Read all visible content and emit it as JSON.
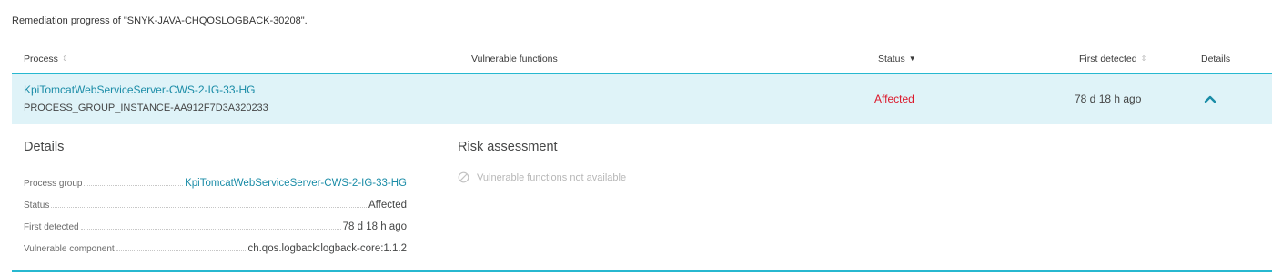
{
  "caption": "Remediation progress of \"SNYK-JAVA-CHQOSLOGBACK-30208\".",
  "table": {
    "headers": {
      "process": "Process",
      "vulnerable_functions": "Vulnerable functions",
      "status": "Status",
      "first_detected": "First detected",
      "details": "Details"
    },
    "rows": [
      {
        "process_name": "KpiTomcatWebServiceServer-CWS-2-IG-33-HG",
        "process_id": "PROCESS_GROUP_INSTANCE-AA912F7D3A320233",
        "status": "Affected",
        "first_detected": "78 d 18 h ago"
      }
    ]
  },
  "details": {
    "title": "Details",
    "items": [
      {
        "label": "Process group",
        "value": "KpiTomcatWebServiceServer-CWS-2-IG-33-HG"
      },
      {
        "label": "Status",
        "value": "Affected"
      },
      {
        "label": "First detected",
        "value": "78 d 18 h ago"
      },
      {
        "label": "Vulnerable component",
        "value": "ch.qos.logback:logback-core:1.1.2"
      }
    ]
  },
  "risk": {
    "title": "Risk assessment",
    "note": "Vulnerable functions not available"
  },
  "icons": {
    "sort_inactive": "sort-both-icon",
    "sort_active": "sort-down-icon",
    "expand": "chevron-up-icon",
    "unavailable": "disabled-circle-icon"
  },
  "colors": {
    "accent": "#27b8d0",
    "link": "#1a8ca7",
    "affected": "#dc172a",
    "selected_row_bg": "#dff3f8"
  }
}
